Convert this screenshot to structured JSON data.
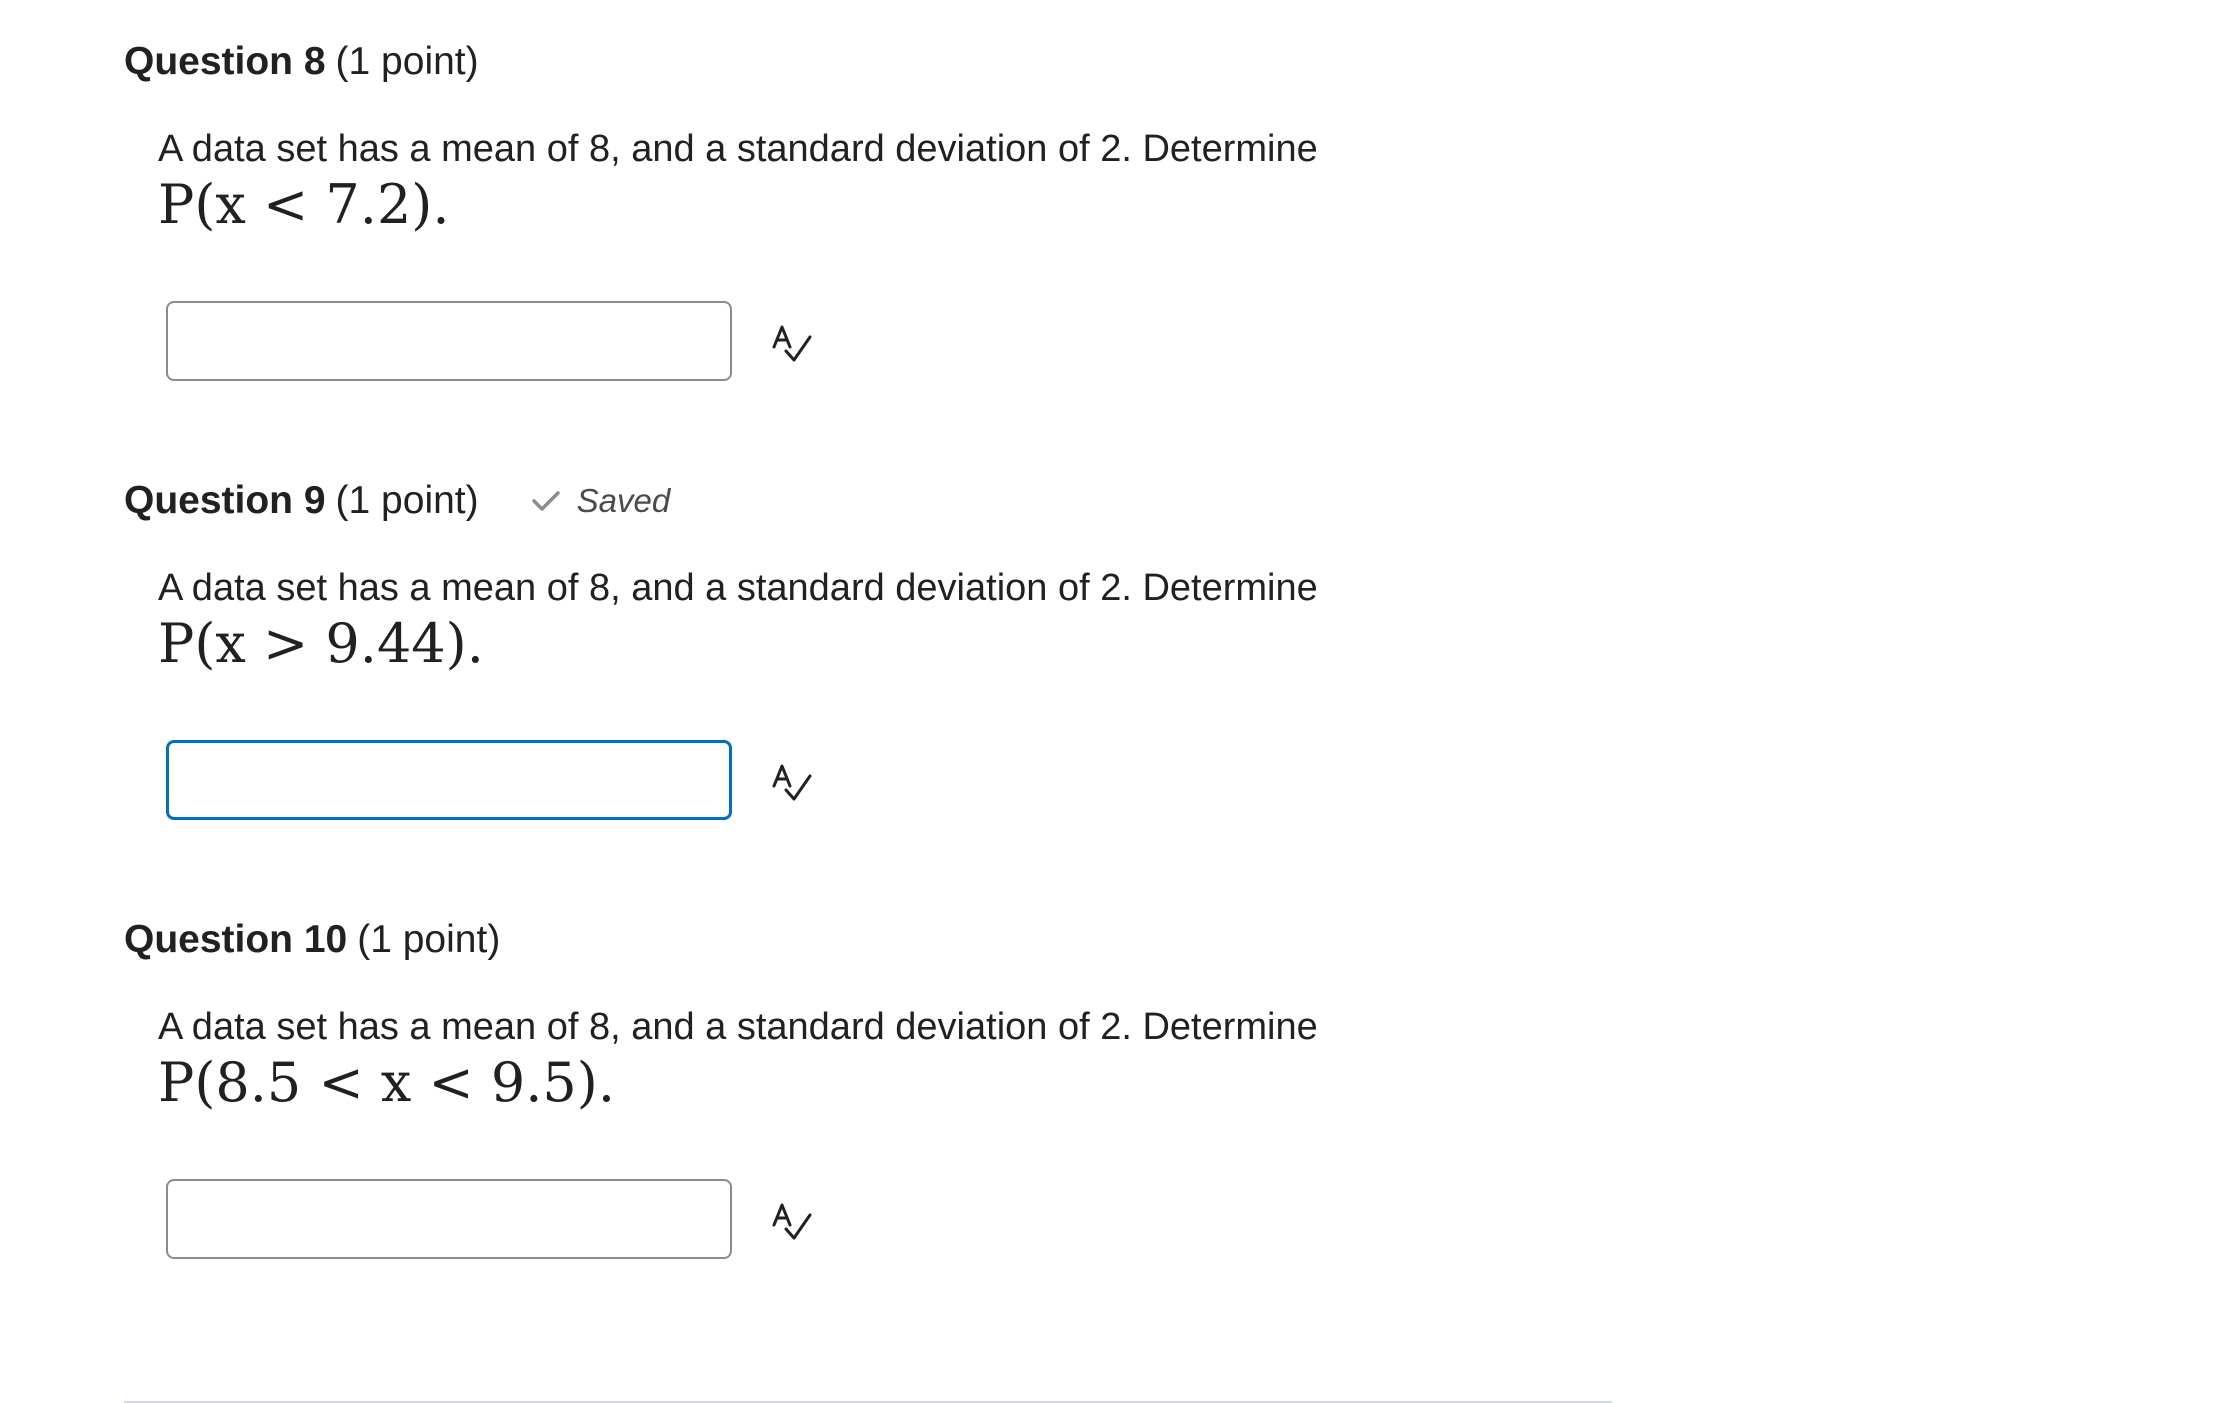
{
  "questions": [
    {
      "title": "Question 8",
      "points": "(1 point)",
      "text": "A data set has a mean of 8, and a standard deviation of 2.  Determine",
      "math": "P(x < 7.2).",
      "answer_value": "",
      "focused": false
    },
    {
      "title": "Question 9",
      "points": "(1 point)",
      "saved_label": "Saved",
      "text": "A data set has a mean of 8, and a standard deviation of 2.  Determine",
      "math": "P(x > 9.44).",
      "answer_value": "",
      "focused": true
    },
    {
      "title": "Question 10",
      "points": "(1 point)",
      "text": "A data set has a mean of 8, and a standard deviation of 2.  Determine",
      "math": "P(8.5 < x < 9.5).",
      "answer_value": "",
      "focused": false
    }
  ],
  "icons": {
    "spell_check": "spell-check-icon",
    "saved": "checkmark-icon"
  },
  "colors": {
    "focus_border": "#006fbf",
    "input_border": "#8a8c8e",
    "saved_text": "#494c4e",
    "check_icon": "#8a8c8e"
  }
}
